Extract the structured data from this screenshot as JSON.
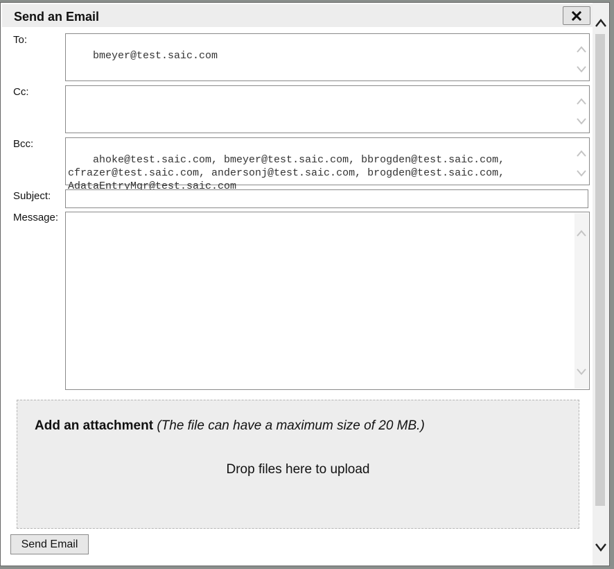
{
  "dialog": {
    "title": "Send an Email",
    "close_icon": "close-icon"
  },
  "form": {
    "to_label": "To:",
    "to_value": "bmeyer@test.saic.com",
    "cc_label": "Cc:",
    "cc_value": "",
    "bcc_label": "Bcc:",
    "bcc_value": "ahoke@test.saic.com, bmeyer@test.saic.com, bbrogden@test.saic.com,\ncfrazer@test.saic.com, andersonj@test.saic.com, brogden@test.saic.com,\nAdataEntryMgr@test.saic.com",
    "subject_label": "Subject:",
    "subject_value": "",
    "message_label": "Message:",
    "message_value": ""
  },
  "attachment": {
    "title_bold": "Add an attachment",
    "title_note": "(The file can have a maximum size of 20 MB.)",
    "drop_text": "Drop files here to upload"
  },
  "actions": {
    "send_label": "Send Email"
  },
  "colors": {
    "titlebar": "#ededed",
    "dropzone": "#ededed",
    "border": "#8a8a8a"
  }
}
